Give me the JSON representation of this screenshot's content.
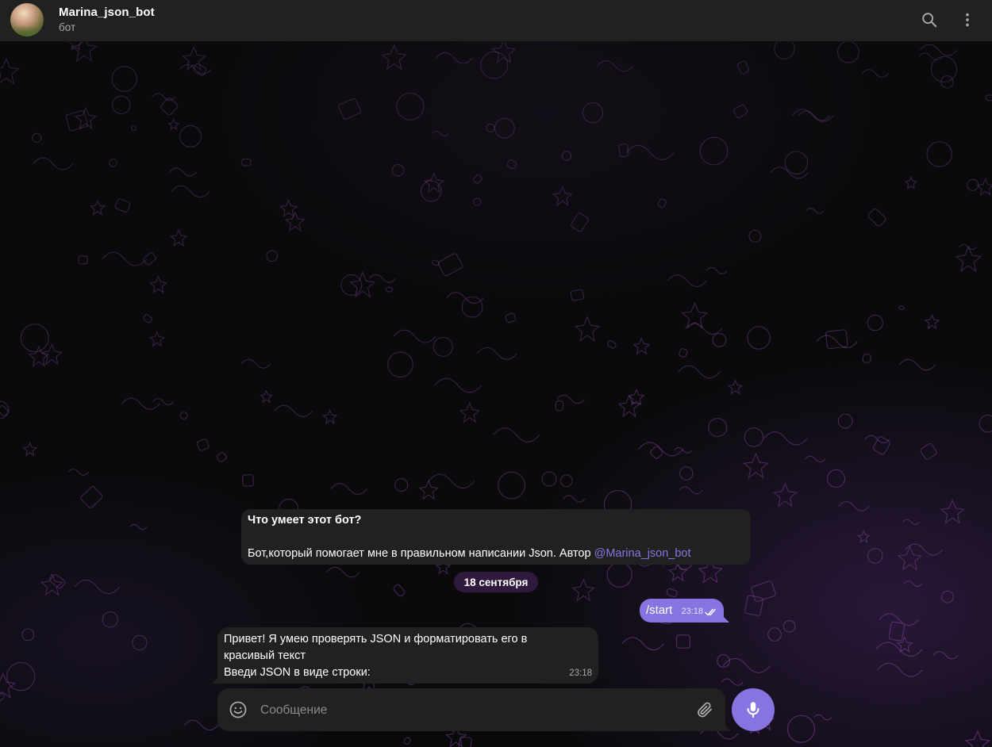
{
  "header": {
    "title": "Marina_json_bot",
    "subtitle": "бот",
    "search_icon": "search-icon",
    "menu_icon": "more-vertical-icon"
  },
  "chat": {
    "bot_info": {
      "question": "Что умеет этот бот?",
      "description": "Бот,который помогает мне в правильном написании Json. Автор ",
      "author_mention": "@Marina_json_bot"
    },
    "date_separator": "18 сентября",
    "messages": [
      {
        "direction": "outgoing",
        "text": "/start",
        "time": "23:18",
        "status": "read"
      },
      {
        "direction": "incoming",
        "lines": [
          "Привет! Я умею проверять JSON и форматировать его в",
          "красивый текст",
          "Введи JSON в виде строки:"
        ],
        "time": "23:18"
      }
    ]
  },
  "composer": {
    "placeholder": "Сообщение",
    "value": "",
    "emoji_icon": "smile-icon",
    "attach_icon": "paperclip-icon",
    "mic_icon": "microphone-icon"
  },
  "colors": {
    "accent": "#8774e1",
    "bubble_in": "#212121",
    "header_bg": "#212121",
    "date_pill": "#2f1a3d"
  }
}
